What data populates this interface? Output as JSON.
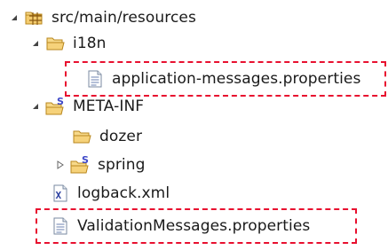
{
  "tree": {
    "items": [
      {
        "label": "src/main/resources",
        "expanded": true,
        "icon": "package-folder-icon"
      },
      {
        "label": "i18n",
        "expanded": true,
        "icon": "folder-open-icon"
      },
      {
        "label": "application-messages.properties",
        "icon": "properties-file-icon",
        "highlighted": true
      },
      {
        "label": "META-INF",
        "expanded": true,
        "icon": "spring-folder-icon"
      },
      {
        "label": "dozer",
        "icon": "folder-open-icon"
      },
      {
        "label": "spring",
        "expanded": false,
        "icon": "spring-folder-icon"
      },
      {
        "label": "logback.xml",
        "icon": "xml-file-icon"
      },
      {
        "label": "ValidationMessages.properties",
        "icon": "properties-file-icon",
        "highlighted": true
      }
    ]
  },
  "colors": {
    "highlight_border": "#e8102f",
    "folder": "#f0c86a",
    "spring_s": "#3f49c8",
    "text": "#1a1a1a"
  }
}
